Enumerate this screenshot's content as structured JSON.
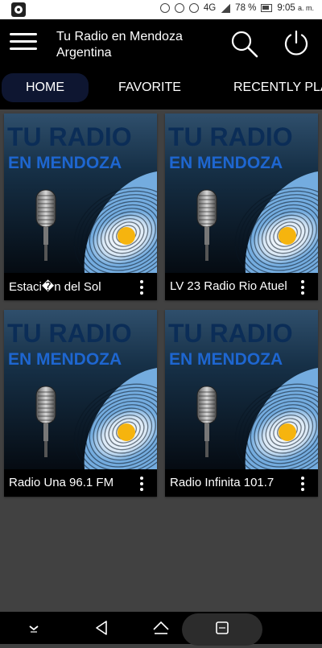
{
  "status_bar": {
    "network": "4G",
    "battery": "78 %",
    "time": "9:05",
    "ampm": "a. m."
  },
  "app_bar": {
    "title_line1": "Tu Radio en Mendoza",
    "title_line2": "Argentina"
  },
  "tabs": [
    {
      "label": "HOME",
      "active": true
    },
    {
      "label": "FAVORITE",
      "active": false
    },
    {
      "label": "RECENTLY PLAYED",
      "active": false
    }
  ],
  "artwork": {
    "line1": "TU RADIO",
    "line2": "EN MENDOZA"
  },
  "stations": [
    {
      "name": "Estaci�n del Sol"
    },
    {
      "name": "LV 23 Radio Rio Atuel"
    },
    {
      "name": "Radio Una 96.1 FM"
    },
    {
      "name": "Radio Infinita 101.7"
    }
  ],
  "colors": {
    "background": "#414141",
    "bar": "#000000",
    "active_tab": "#0e1631",
    "art_text": "#1e66d0",
    "flag_blue": "#74acdf",
    "sun": "#f6b40e"
  }
}
